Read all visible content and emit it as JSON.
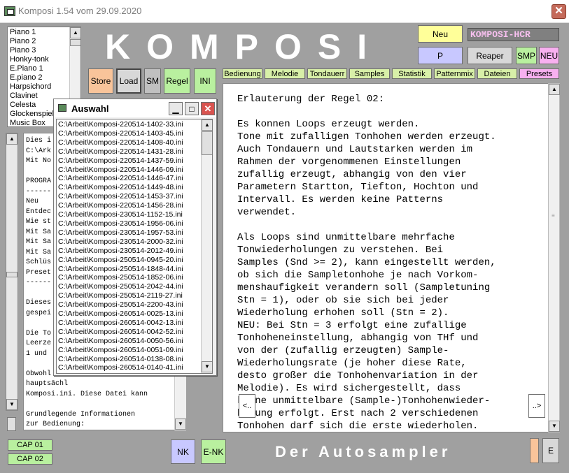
{
  "window": {
    "title": "Komposi 1.54 vom 29.09.2020",
    "close_glyph": "✕"
  },
  "instruments": [
    "Piano 1",
    "Piano 2",
    "Piano 3",
    "Honky-tonk",
    "E.Piano 1",
    "E.piano 2",
    "Harpsichord",
    "Clavinet",
    "Celesta",
    "Glockenspiel",
    "Music Box"
  ],
  "app_title": "KOMPOSI",
  "subtitle": "Der Autosampler",
  "buttons": {
    "store": "Store",
    "load": "Load",
    "sm": "SM",
    "regel": "Regel",
    "ini": "INI",
    "neu": "Neu",
    "p": "P",
    "reaper": "Reaper",
    "smp": "SMP",
    "neu2": "NEU",
    "nk": "NK",
    "enk": "E-NK",
    "e": "E",
    "cap01": "CAP 01",
    "cap02": "CAP 02",
    "prev": "<..",
    "next": "..>"
  },
  "name_field": "KOMPOSI-HCR",
  "tabs": [
    "Bedienung",
    "Melodie",
    "Tondauerr",
    "Samples",
    "Statistik",
    "Patternmix",
    "Dateien",
    "Presets"
  ],
  "colors": {
    "store": "#f9c49a",
    "load": "#d8d8d8",
    "sm": "#c0c0c0",
    "regel": "#b9f09f",
    "ini": "#b9f09f",
    "neu": "#ffff99",
    "p": "#c8c8ff",
    "reaper": "#d8d8d8",
    "smp": "#b9f09f",
    "neu2": "#f8b0f0",
    "nk": "#c8c8ff",
    "enk": "#b9f09f",
    "tab": "#d8f0a8",
    "tab_presets": "#f8b0f0"
  },
  "dialog": {
    "title": "Auswahl",
    "files": [
      "C:\\Arbeit\\Komposi-220514-1402-33.ini",
      "C:\\Arbeit\\Komposi-220514-1403-45.ini",
      "C:\\Arbeit\\Komposi-220514-1408-40.ini",
      "C:\\Arbeit\\Komposi-220514-1431-28.ini",
      "C:\\Arbeit\\Komposi-220514-1437-59.ini",
      "C:\\Arbeit\\Komposi-220514-1446-09.ini",
      "C:\\Arbeit\\Komposi-220514-1446-47.ini",
      "C:\\Arbeit\\Komposi-220514-1449-48.ini",
      "C:\\Arbeit\\Komposi-220514-1453-37.ini",
      "C:\\Arbeit\\Komposi-220514-1456-28.ini",
      "C:\\Arbeit\\Komposi-230514-1152-15.ini",
      "C:\\Arbeit\\Komposi-230514-1956-06.ini",
      "C:\\Arbeit\\Komposi-230514-1957-53.ini",
      "C:\\Arbeit\\Komposi-230514-2000-32.ini",
      "C:\\Arbeit\\Komposi-230514-2012-49.ini",
      "C:\\Arbeit\\Komposi-250514-0945-20.ini",
      "C:\\Arbeit\\Komposi-250514-1848-44.ini",
      "C:\\Arbeit\\Komposi-250514-1852-06.ini",
      "C:\\Arbeit\\Komposi-250514-2042-44.ini",
      "C:\\Arbeit\\Komposi-250514-2119-27.ini",
      "C:\\Arbeit\\Komposi-250514-2200-43.ini",
      "C:\\Arbeit\\Komposi-260514-0025-13.ini",
      "C:\\Arbeit\\Komposi-260514-0042-13.ini",
      "C:\\Arbeit\\Komposi-260514-0042-52.ini",
      "C:\\Arbeit\\Komposi-260514-0050-56.ini",
      "C:\\Arbeit\\Komposi-260514-0051-09.ini",
      "C:\\Arbeit\\Komposi-260514-0138-08.ini",
      "C:\\Arbeit\\Komposi-260514-0140-41.ini"
    ]
  },
  "left_text": [
    "Dies i",
    "C:\\Ark",
    "Mit No",
    "",
    "PROGRA",
    "------",
    "Neu",
    "Entdec",
    "Wie st",
    "Mit Sa",
    "Mit Sa",
    "Mit Sa",
    "Schlüs",
    "Preset",
    "------",
    "",
    "Dieses",
    "gespei",
    "",
    "Die To",
    "Leerze",
    "1 und",
    "",
    "Obwohl",
    "hauptsächl",
    "Komposi.ini. Diese Datei kann",
    "",
    "Grundlegende Informationen",
    "zur Bedienung:"
  ],
  "main_text": [
    "Erlauterung der Regel 02:",
    "",
    "Es konnen Loops erzeugt werden.",
    "Tone mit zufalligen Tonhohen werden erzeugt.",
    "Auch Tondauern und Lautstarken werden im",
    "Rahmen der vorgenommenen Einstellungen",
    "zufallig erzeugt, abhangig von den vier",
    "Parametern Startton, Tiefton, Hochton und",
    "Intervall. Es werden keine Patterns",
    "verwendet.",
    "",
    "Als Loops sind unmittelbare mehrfache",
    "Tonwiederholungen zu verstehen. Bei",
    "Samples (Snd >= 2), kann eingestellt werden,",
    "ob sich die Sampletonhohe je nach Vorkom-",
    "menshaufigkeit verandern soll (Sampletuning",
    "Stn = 1), oder ob sie sich bei jeder",
    "Wiederholung erhohen soll (Stn = 2).",
    "NEU: Bei Stn = 3 erfolgt eine zufallige",
    "Tonhoheneinstellung, abhangig von THf und",
    "von der (zufallig erzeugten) Sample-",
    "Wiederholungsrate (je hoher diese Rate,",
    "desto großer die Tonhohenvariation in der",
    "Melodie). Es wird sichergestellt, dass",
    "keine unmittelbare (Sample-)Tonhohenwieder-",
    "holung erfolgt. Erst nach 2 verschiedenen",
    "Tonhohen darf sich die erste wiederholen."
  ]
}
